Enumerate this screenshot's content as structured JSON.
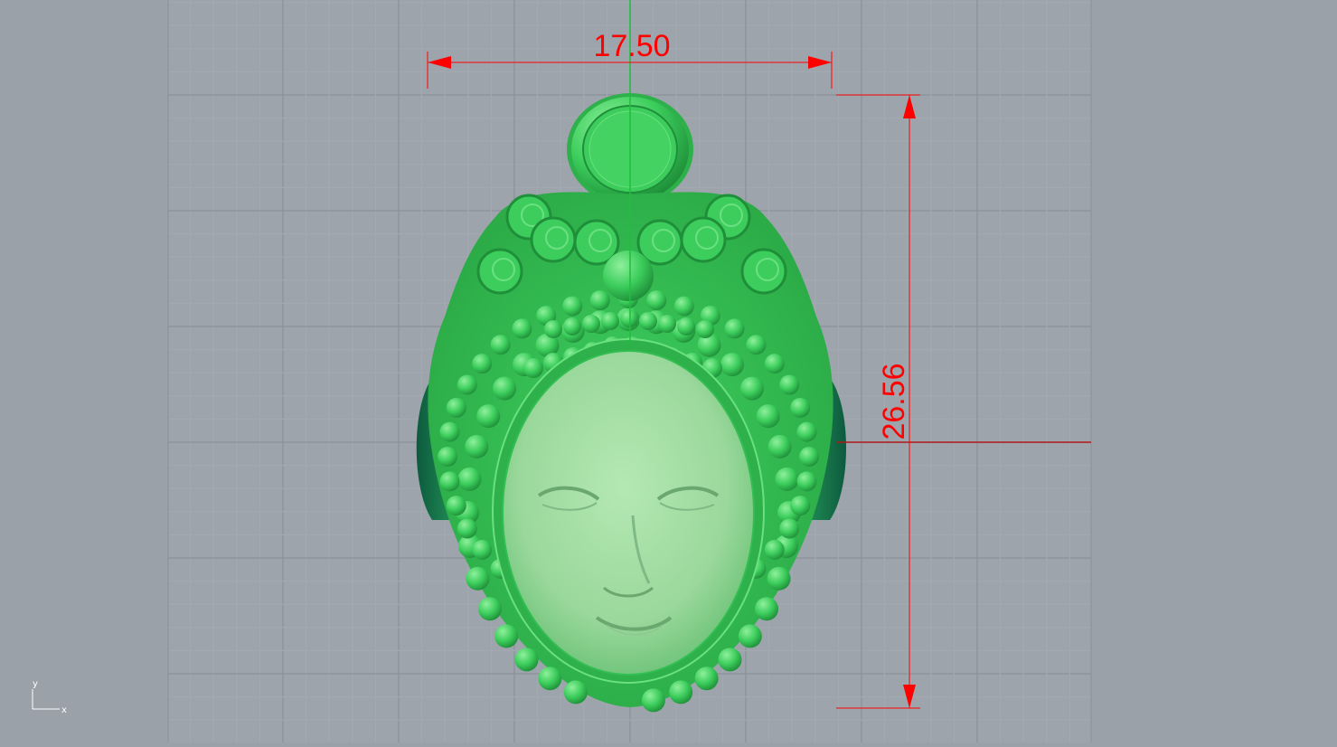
{
  "viewport": {
    "background_color": "#9aa1a9",
    "grid_area_color": "#9da4ac",
    "minor_grid_color": "#a3aab2",
    "major_grid_color": "#8a9199",
    "model_color": "#3ccd5c",
    "face_color": "#a6e0a6",
    "dimension_color": "#ff0000",
    "y_axis_color": "#1fbf3a",
    "x_axis_color": "#b01818"
  },
  "dimensions": {
    "width_label": "17.50",
    "height_label": "26.56"
  },
  "axis_indicator": {
    "y_label": "y",
    "x_label": "x"
  }
}
